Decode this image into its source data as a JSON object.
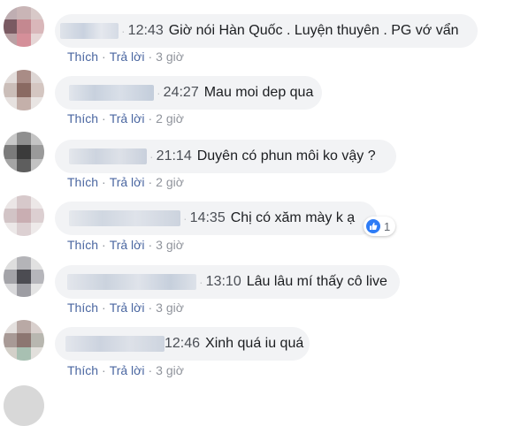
{
  "comments": [
    {
      "time": "12:43",
      "text": "Giờ nói Hàn Quốc . Luyện thuyên . PG vớ vẩn",
      "reply_label": "Trả lời",
      "like_label": "Thích",
      "age": "3 giờ"
    },
    {
      "time": "24:27",
      "text": "Mau moi dep qua",
      "reply_label": "Trả lời",
      "like_label": "Thích",
      "age": "2 giờ"
    },
    {
      "time": "21:14",
      "text": "Duyên có phun môi ko vậy ?",
      "reply_label": "Trả lời",
      "like_label": "Thích",
      "age": "2 giờ"
    },
    {
      "time": "14:35",
      "text": "Chị có xăm mày k ạ",
      "reply_label": "Trả lời",
      "like_label": "Thích",
      "age": "3 giờ",
      "reaction_count": "1",
      "reaction_icon": "thumbs-up-icon"
    },
    {
      "time": "13:10",
      "text": "Lâu lâu mí thấy cô live",
      "reply_label": "Trả lời",
      "like_label": "Thích",
      "age": "3 giờ"
    },
    {
      "time": "12:46",
      "text": "Xinh quá iu quá",
      "reply_label": "Trả lời",
      "like_label": "Thích",
      "age": "3 giờ"
    }
  ],
  "colors": {
    "link": "#4b67a1",
    "meta": "#90949c",
    "bubble": "#f2f3f5",
    "like_blue": "#2e7cf6"
  }
}
